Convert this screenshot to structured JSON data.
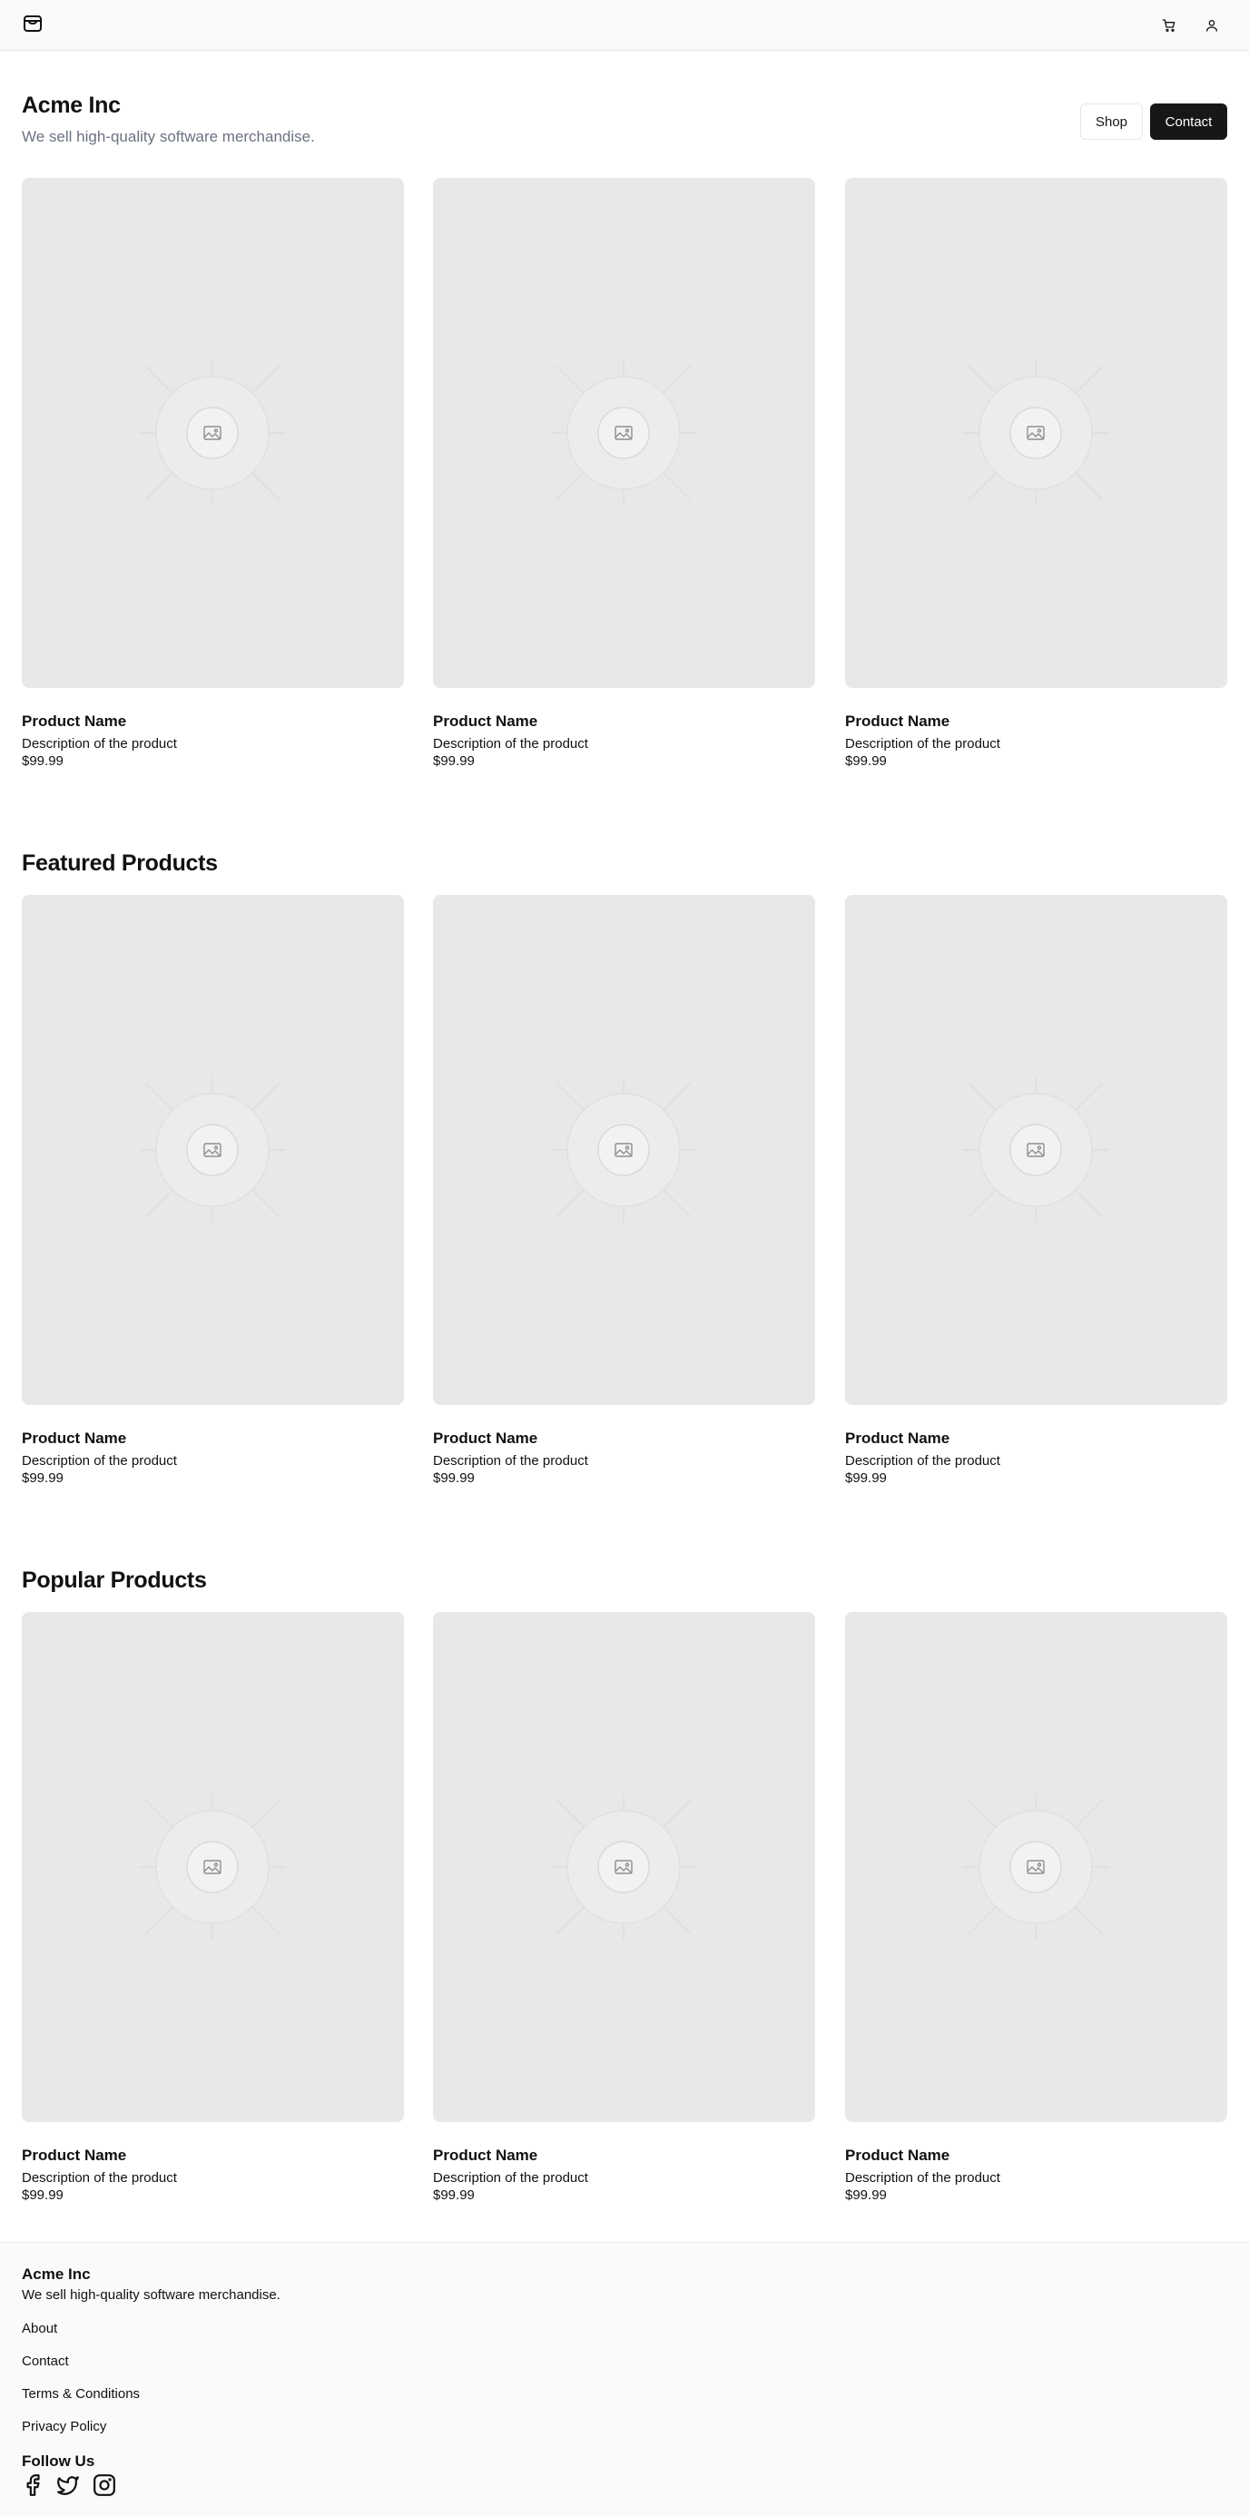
{
  "header": {
    "logo_icon": "store-icon",
    "cart_icon": "cart-icon",
    "account_icon": "user-icon"
  },
  "hero": {
    "title": "Acme Inc",
    "subtitle": "We sell high-quality software merchandise.",
    "shop_label": "Shop",
    "contact_label": "Contact"
  },
  "sections": [
    {
      "title": "",
      "products": [
        {
          "name": "Product Name",
          "description": "Description of the product",
          "price": "$99.99"
        },
        {
          "name": "Product Name",
          "description": "Description of the product",
          "price": "$99.99"
        },
        {
          "name": "Product Name",
          "description": "Description of the product",
          "price": "$99.99"
        }
      ]
    },
    {
      "title": "Featured Products",
      "products": [
        {
          "name": "Product Name",
          "description": "Description of the product",
          "price": "$99.99"
        },
        {
          "name": "Product Name",
          "description": "Description of the product",
          "price": "$99.99"
        },
        {
          "name": "Product Name",
          "description": "Description of the product",
          "price": "$99.99"
        }
      ]
    },
    {
      "title": "Popular Products",
      "products": [
        {
          "name": "Product Name",
          "description": "Description of the product",
          "price": "$99.99"
        },
        {
          "name": "Product Name",
          "description": "Description of the product",
          "price": "$99.99"
        },
        {
          "name": "Product Name",
          "description": "Description of the product",
          "price": "$99.99"
        }
      ]
    }
  ],
  "footer": {
    "title": "Acme Inc",
    "subtitle": "We sell high-quality software merchandise.",
    "links": [
      "About",
      "Contact",
      "Terms & Conditions",
      "Privacy Policy"
    ],
    "follow_title": "Follow Us",
    "social_icons": [
      "facebook-icon",
      "twitter-icon",
      "instagram-icon"
    ]
  },
  "colors": {
    "primary_button": "#171717",
    "placeholder_bg": "#e8e8e8",
    "muted_text": "#6b7280"
  }
}
